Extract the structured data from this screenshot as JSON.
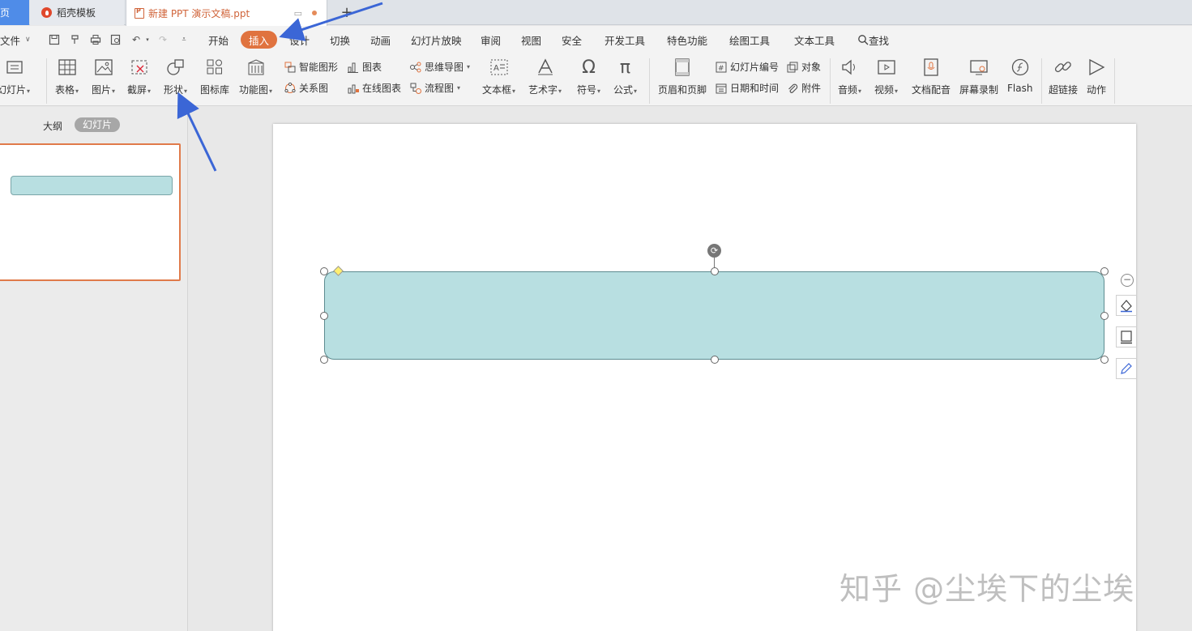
{
  "tabs": {
    "home": "页",
    "template": "稻壳模板",
    "document": "新建 PPT 演示文稿.ppt",
    "add": "+"
  },
  "menu": {
    "file": "文件",
    "items": [
      "开始",
      "插入",
      "设计",
      "切换",
      "动画",
      "幻灯片放映",
      "审阅",
      "视图",
      "安全",
      "开发工具",
      "特色功能",
      "绘图工具",
      "文本工具"
    ],
    "search": "查找"
  },
  "ribbon": {
    "new_slide": "幻灯片",
    "table": "表格",
    "picture": "图片",
    "screenshot": "截屏",
    "shape": "形状",
    "icon_lib": "图标库",
    "function_chart": "功能图",
    "smart_art": "智能图形",
    "chart": "图表",
    "relation": "关系图",
    "online_chart": "在线图表",
    "mind_map": "思维导图",
    "flowchart": "流程图",
    "textbox": "文本框",
    "art_text": "艺术字",
    "symbol": "符号",
    "formula": "公式",
    "header_footer": "页眉和页脚",
    "slide_number": "幻灯片编号",
    "object": "对象",
    "date_time": "日期和时间",
    "attachment": "附件",
    "audio": "音频",
    "video": "视频",
    "doc_audio": "文档配音",
    "screen_record": "屏幕录制",
    "flash": "Flash",
    "hyperlink": "超链接",
    "action": "动作"
  },
  "left_panel": {
    "outline": "大纲",
    "slides": "幻灯片"
  },
  "watermark": "知乎 @尘埃下的尘埃",
  "colors": {
    "accent": "#e0733f",
    "shape_fill": "#b8dfe1",
    "annotation_arrow": "#3b66d6"
  }
}
